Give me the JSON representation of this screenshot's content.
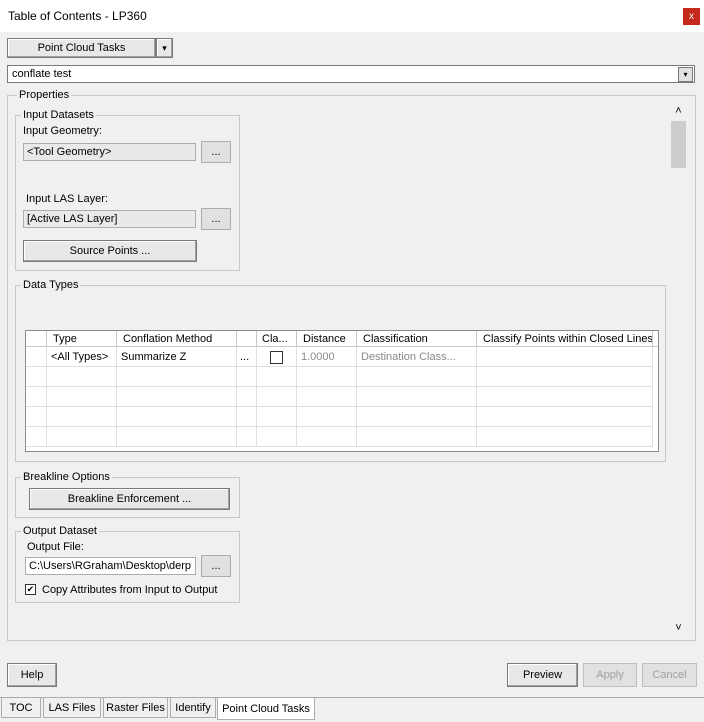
{
  "window": {
    "title": "Table of Contents - LP360",
    "close_glyph": "x"
  },
  "tool_selector": {
    "label": "Point Cloud Tasks",
    "arrow": "▾"
  },
  "task_combo": {
    "value": "conflate test",
    "arrow": "▾"
  },
  "properties": {
    "legend": "Properties",
    "input_datasets": {
      "legend": "Input Datasets",
      "geometry_label": "Input Geometry:",
      "geometry_value": "<Tool Geometry>",
      "browse": "...",
      "las_label": "Input LAS Layer:",
      "las_value": "[Active LAS Layer]",
      "source_points": "Source Points ..."
    },
    "data_types": {
      "legend": "Data Types",
      "columns": [
        "Type",
        "Conflation Method",
        "",
        "Cla...",
        "Distance",
        "Classification",
        "Classify Points within Closed Lines"
      ],
      "rows": [
        {
          "type": "<All Types>",
          "method": "Summarize Z",
          "dots": "...",
          "checked": "",
          "distance": "1.0000",
          "classification": "Destination Class...",
          "closed": ""
        }
      ]
    },
    "breakline": {
      "legend": "Breakline Options",
      "button": "Breakline Enforcement ..."
    },
    "output": {
      "legend": "Output Dataset",
      "file_label": "Output File:",
      "file_value": "C:\\Users\\RGraham\\Desktop\\derp",
      "browse": "...",
      "copy_attrs_label": "Copy Attributes from Input to Output",
      "copy_attrs_checked": "✔"
    }
  },
  "scrollbar": {
    "up": "˄",
    "down": "˅"
  },
  "buttons": {
    "help": "Help",
    "preview": "Preview",
    "apply": "Apply",
    "cancel": "Cancel"
  },
  "tabs": [
    "TOC",
    "LAS Files",
    "Raster Files",
    "Identify",
    "Point Cloud Tasks"
  ]
}
